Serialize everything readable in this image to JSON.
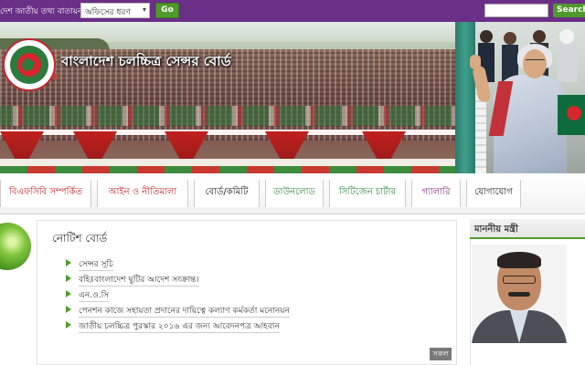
{
  "topbar": {
    "portal_text": "দেশ জাতীয় তথ্য বাতায়ন",
    "office_select_value": "অফিসের ধরণ",
    "go_label": "Go",
    "search_placeholder": "",
    "search_label": "Search"
  },
  "banner": {
    "title": "বাংলাদেশ চলচ্চিত্র সেন্সর বোর্ড"
  },
  "nav": {
    "items": [
      {
        "label": "বিএফসিবি সম্পর্কিত"
      },
      {
        "label": "আইন ও নীতিমালা"
      },
      {
        "label": "বোর্ড/কমিটি"
      },
      {
        "label": "ডাউনলোড"
      },
      {
        "label": "সিটিজেন চার্টার"
      },
      {
        "label": "গ্যালারি"
      },
      {
        "label": "যোগাযোগ"
      }
    ]
  },
  "notice": {
    "title": "নোটিশ বোর্ড",
    "items": [
      "সেন্সর সূচি",
      "বহিঃবাংলাদেশ ছুটির আদেশ সংক্রান্ত।",
      "এন.ও.সি",
      "পেনশন কাজে সহায়তা প্রদানের দায়িত্বে কল্যাণ কর্মকর্তা মনোনয়ন",
      "জাতীয় চলচ্চিত্র পুরস্কার ২০১৬ এর জন্য আবেদনপত্র আহবান"
    ],
    "all_label": "সকল"
  },
  "minister": {
    "heading": "মাননীয় মন্ত্রী"
  },
  "colors": {
    "topbar": "#6a2f86",
    "accent_green": "#4f9a2c",
    "nav_red": "#c3272c"
  }
}
